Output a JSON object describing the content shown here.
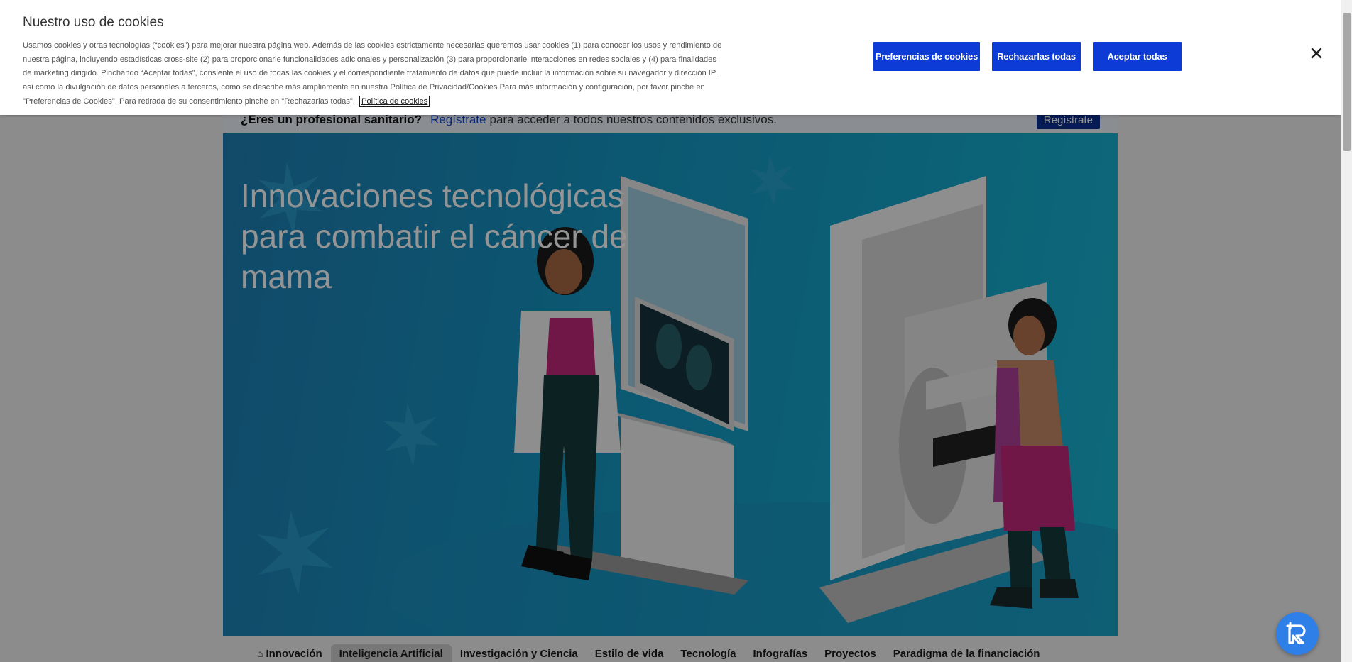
{
  "cookie_banner": {
    "title": "Nuestro uso de cookies",
    "body": "Usamos cookies y otras tecnologías (“cookies”) para mejorar nuestra página web. Además de las cookies estrictamente necesarias queremos usar cookies (1) para conocer los usos y rendimiento de nuestra página, incluyendo estadísticas cross-site (2) para proporcionarle funcionalidades adicionales y personalización (3) para proporcionarle interacciones en redes sociales y (4) para finalidades de marketing dirigido. Pinchando “Aceptar todas”, consiente el uso de todas las cookies y el correspondiente tratamiento de datos que puede incluir la información sobre su navegador y dirección IP, así como la divulgación de datos personales a terceros, como se describe más ampliamente en nuestra Política de Privacidad/Cookies.Para más información y configuración, por favor pinche en \"Preferencias de Cookies\". Para retirada de su consentimiento pinche en \"Rechazarlas todas\".",
    "policy_link": "Política de cookies",
    "buttons": {
      "preferences": "Preferencias de cookies",
      "reject": "Rechazarlas todas",
      "accept": "Aceptar todas"
    },
    "close_icon": "close-icon"
  },
  "pro_bar": {
    "question": "¿Eres un profesional sanitario?",
    "link": "Regístrate",
    "text": "para acceder a todos nuestros contenidos exclusivos.",
    "button": "Regístrate"
  },
  "hero": {
    "title": "Innovaciones tecnológicas para combatir el cáncer de mama"
  },
  "nav": {
    "tabs": [
      {
        "label": "Innovación",
        "icon": "home-icon",
        "active": false
      },
      {
        "label": "Inteligencia Artificial",
        "active": true
      },
      {
        "label": "Investigación y Ciencia",
        "active": false
      },
      {
        "label": "Estilo de vida",
        "active": false
      },
      {
        "label": "Tecnología",
        "active": false
      },
      {
        "label": "Infografías",
        "active": false
      },
      {
        "label": "Proyectos",
        "active": false
      },
      {
        "label": "Paradigma de la financiación",
        "active": false
      }
    ]
  },
  "colors": {
    "primary_button": "#0d3bd6",
    "hero_bg": "#1596c4",
    "float_button": "#2f7fe8"
  },
  "float_button_icon": "robot-assistant-icon"
}
